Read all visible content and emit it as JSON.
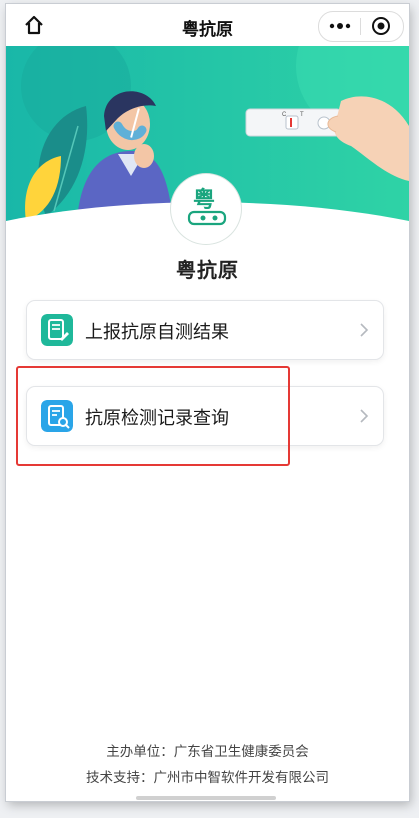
{
  "nav": {
    "title": "粤抗原",
    "home_icon": "home-icon",
    "more_icon": "more-dots-icon",
    "close_icon": "target-close-icon"
  },
  "banner": {
    "test_strip_marks": [
      "C",
      "T"
    ]
  },
  "logo": {
    "text": "粤",
    "icon": "test-kit-logo"
  },
  "page_title": "粤抗原",
  "menu": [
    {
      "label": "上报抗原自测结果",
      "icon": "report-form-icon",
      "icon_color": "#1fb89a"
    },
    {
      "label": "抗原检测记录查询",
      "icon": "record-search-icon",
      "icon_color": "#2aa5e8"
    }
  ],
  "footer": {
    "organizer": "主办单位：广东省卫生健康委员会",
    "support": "技术支持：广州市中智软件开发有限公司"
  },
  "colors": {
    "brand_teal": "#1ec3a0",
    "highlight_red": "#e53935"
  }
}
